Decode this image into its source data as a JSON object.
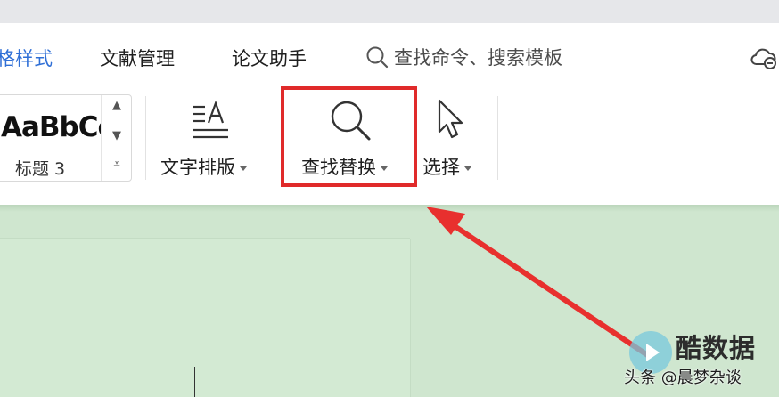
{
  "tabs": [
    {
      "label": "格样式",
      "active": true
    },
    {
      "label": "文献管理",
      "active": false
    },
    {
      "label": "论文助手",
      "active": false
    }
  ],
  "search": {
    "placeholder": "查找命令、搜索模板"
  },
  "style_gallery": {
    "sample": "AaBbCc",
    "name": "标题 3"
  },
  "tools": {
    "text_layout": "文字排版",
    "find_replace": "查找替换",
    "select": "选择"
  },
  "watermark": {
    "brand": "酷数据",
    "source": "头条 @晨梦杂谈"
  },
  "colors": {
    "accent": "#2f6fd6",
    "highlight": "#e02a2a",
    "document_bg": "#cfe6cf"
  }
}
